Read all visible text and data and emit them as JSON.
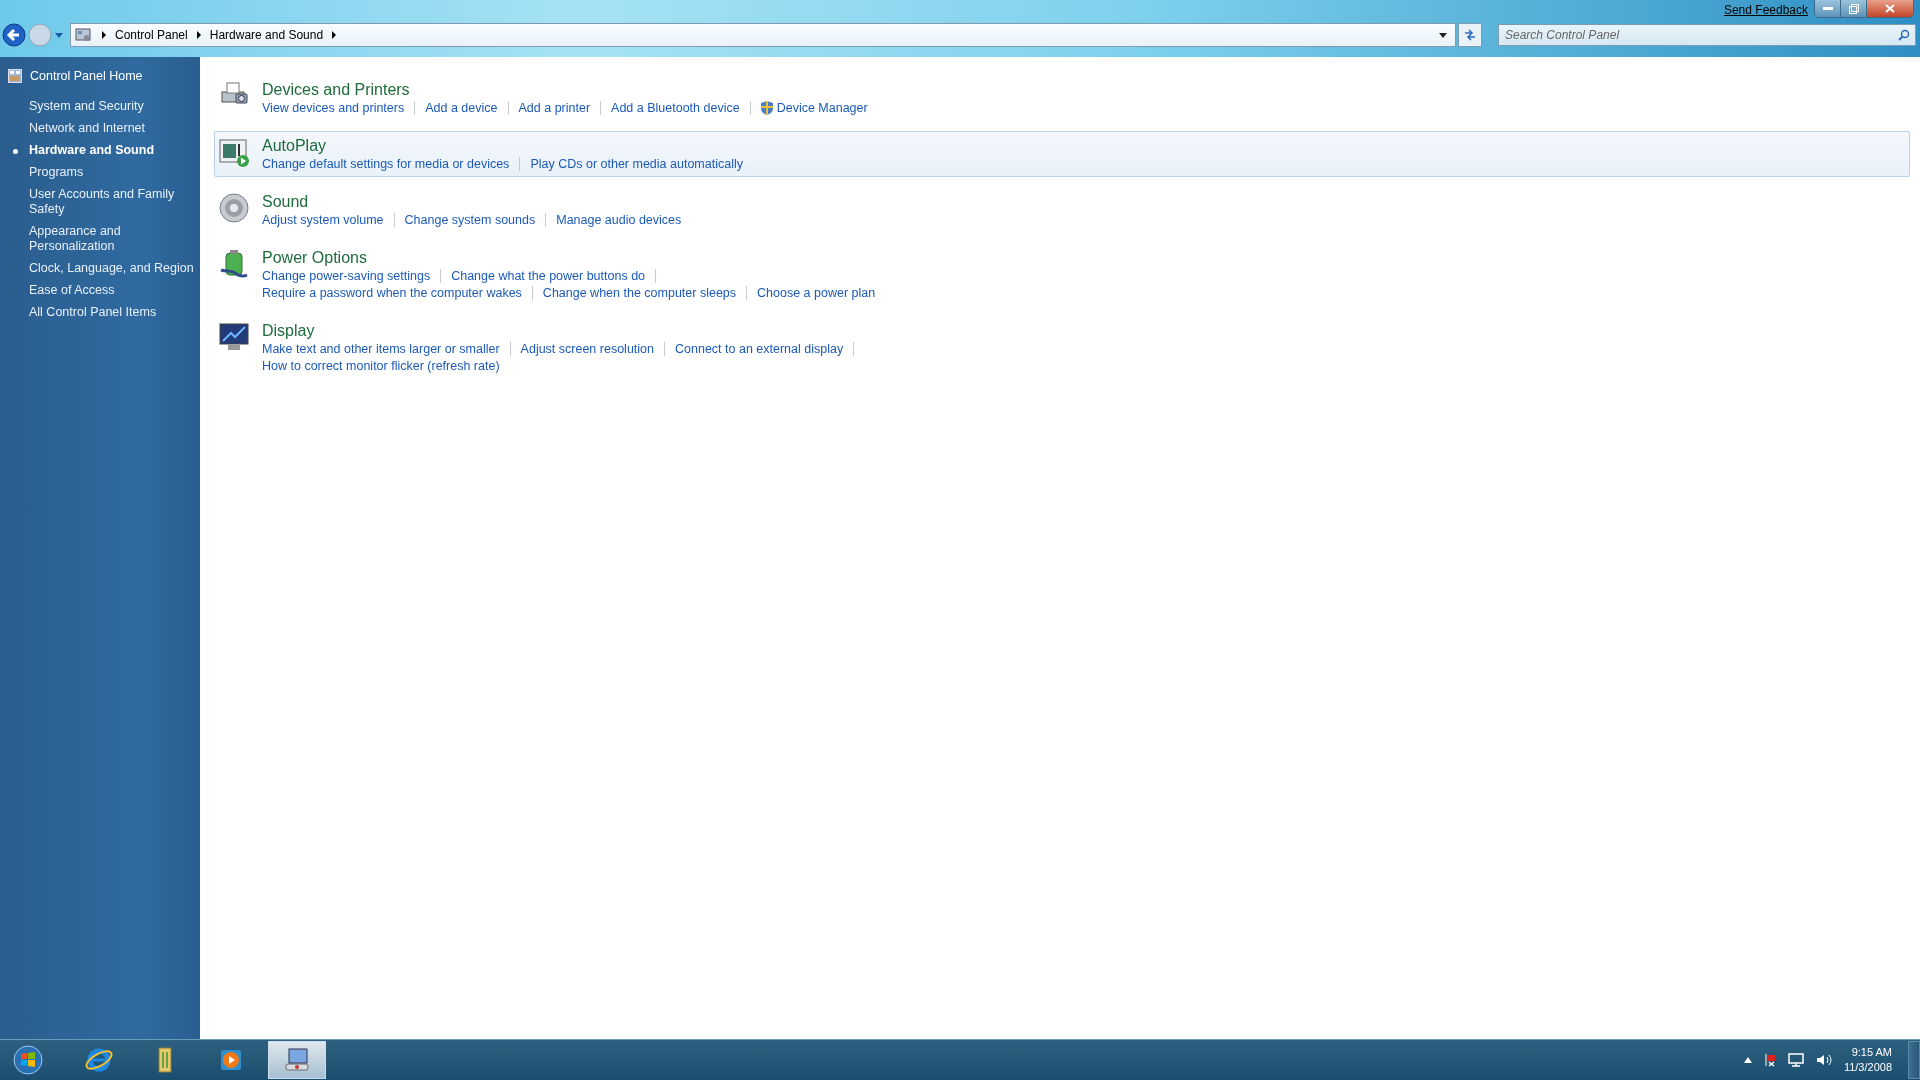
{
  "window": {
    "send_feedback": "Send Feedback"
  },
  "address_bar": {
    "crumbs": [
      "Control Panel",
      "Hardware and Sound"
    ]
  },
  "search": {
    "placeholder": "Search Control Panel"
  },
  "sidebar": {
    "home": "Control Panel Home",
    "items": [
      {
        "label": "System and Security",
        "selected": false
      },
      {
        "label": "Network and Internet",
        "selected": false
      },
      {
        "label": "Hardware and Sound",
        "selected": true
      },
      {
        "label": "Programs",
        "selected": false
      },
      {
        "label": "User Accounts and Family Safety",
        "selected": false
      },
      {
        "label": "Appearance and Personalization",
        "selected": false
      },
      {
        "label": "Clock, Language, and Region",
        "selected": false
      },
      {
        "label": "Ease of Access",
        "selected": false
      },
      {
        "label": "All Control Panel Items",
        "selected": false
      }
    ]
  },
  "sections": [
    {
      "kind": "printer",
      "title": "Devices and Printers",
      "highlighted": false,
      "lines": [
        [
          {
            "label": "View devices and printers",
            "shield": false
          },
          {
            "label": "Add a device",
            "shield": false
          },
          {
            "label": "Add a printer",
            "shield": false
          },
          {
            "label": "Add a Bluetooth device",
            "shield": false
          },
          {
            "label": "Device Manager",
            "shield": true
          }
        ]
      ]
    },
    {
      "kind": "autoplay",
      "title": "AutoPlay",
      "highlighted": true,
      "lines": [
        [
          {
            "label": "Change default settings for media or devices",
            "shield": false
          },
          {
            "label": "Play CDs or other media automatically",
            "shield": false
          }
        ]
      ]
    },
    {
      "kind": "speaker",
      "title": "Sound",
      "highlighted": false,
      "lines": [
        [
          {
            "label": "Adjust system volume",
            "shield": false
          },
          {
            "label": "Change system sounds",
            "shield": false
          },
          {
            "label": "Manage audio devices",
            "shield": false
          }
        ]
      ]
    },
    {
      "kind": "battery",
      "title": "Power Options",
      "highlighted": false,
      "lines": [
        [
          {
            "label": "Change power-saving settings",
            "shield": false
          },
          {
            "label": "Change what the power buttons do",
            "shield": false
          }
        ],
        [
          {
            "label": "Require a password when the computer wakes",
            "shield": false
          },
          {
            "label": "Change when the computer sleeps",
            "shield": false
          },
          {
            "label": "Choose a power plan",
            "shield": false
          }
        ]
      ]
    },
    {
      "kind": "monitor",
      "title": "Display",
      "highlighted": false,
      "lines": [
        [
          {
            "label": "Make text and other items larger or smaller",
            "shield": false
          },
          {
            "label": "Adjust screen resolution",
            "shield": false
          },
          {
            "label": "Connect to an external display",
            "shield": false
          }
        ],
        [
          {
            "label": "How to correct monitor flicker (refresh rate)",
            "shield": false
          }
        ]
      ]
    }
  ],
  "taskbar": {
    "apps": [
      {
        "kind": "browser",
        "selected": false
      },
      {
        "kind": "folder",
        "selected": false
      },
      {
        "kind": "media",
        "selected": false
      },
      {
        "kind": "control",
        "selected": true
      }
    ]
  },
  "clock": {
    "time": "9:15 AM",
    "date": "11/3/2008"
  }
}
